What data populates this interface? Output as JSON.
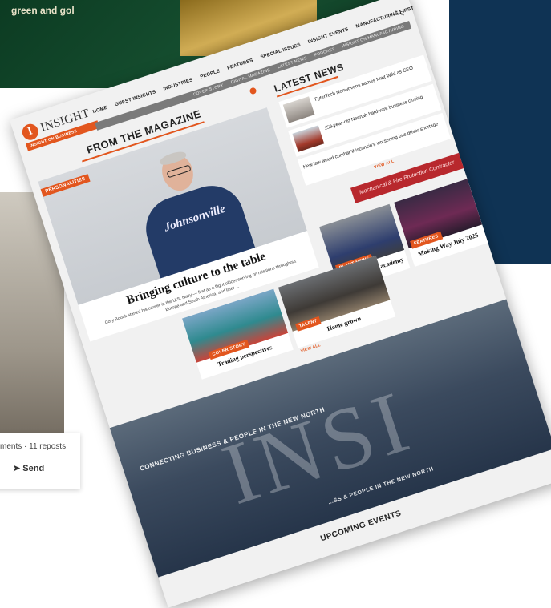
{
  "background": {
    "green_text": "green and gol",
    "reposts": "ments · 11 reposts",
    "send": "Send"
  },
  "header": {
    "logo_letter": "I",
    "logo_text": "INSIGHT",
    "logo_sub": "INSIGHT ON BUSINESS",
    "nav": [
      "HOME",
      "GUEST INSIGHTS",
      "INDUSTRIES",
      "PEOPLE",
      "FEATURES",
      "SPECIAL ISSUES",
      "INSIGHT EVENTS",
      "MANUFACTURING FIRST"
    ],
    "subnav": [
      "COVER STORY",
      "DIGITAL MAGAZINE",
      "LATEST NEWS",
      "PODCAST",
      "INSIGHT ON MANUFACTURING"
    ]
  },
  "magazine": {
    "section_title": "FROM THE MAGAZINE",
    "hero_badge": "PERSONALITIES",
    "shirt_text": "Johnsonville",
    "hero_headline": "Bringing culture to the table",
    "hero_caption": "Cory Bouck started his career in the U.S. Navy — first as a flight officer serving on missions throughout Europe and South America, and later ...",
    "cards": [
      {
        "badge": "PLANT NEWS",
        "title": "Anatomy of an academy"
      },
      {
        "badge": "FEATURES",
        "title": "Making Way July 2025"
      },
      {
        "badge": "COVER STORY",
        "title": "Trading perspectives"
      },
      {
        "badge": "TALENT",
        "title": "Home grown"
      }
    ],
    "view_all": "VIEW ALL"
  },
  "latest_news": {
    "title": "LATEST NEWS",
    "items": [
      {
        "text": "FyterTech Nonwovens names Matt Wild as CEO"
      },
      {
        "text": "159-year-old Neenah hardware business closing"
      },
      {
        "text": "New law would combat Wisconsin's worsening bus driver shortage"
      }
    ],
    "view_all": "VIEW ALL",
    "ad_text": "Mechanical & Fire Protection Contractor"
  },
  "banner": {
    "tagline": "CONNECTING BUSINESS & PEOPLE IN THE NEW NORTH",
    "tagline_2": "…SS & PEOPLE IN THE NEW NORTH",
    "big_text": "INSI"
  },
  "upcoming": {
    "title": "UPCOMING EVENTS"
  },
  "colors": {
    "accent": "#e2561e",
    "navy": "#0f3354",
    "subnav_gray": "#7a7a7a"
  }
}
